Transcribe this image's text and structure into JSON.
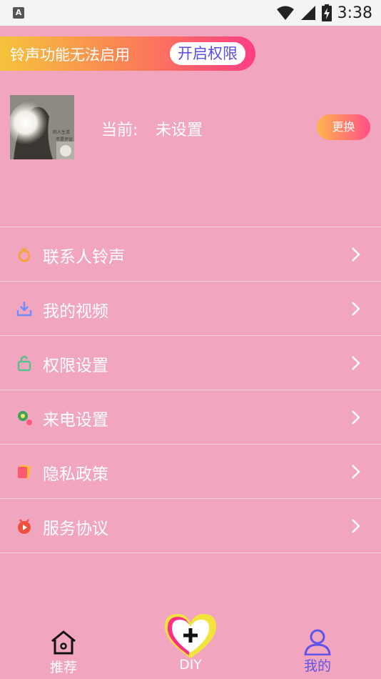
{
  "status_bar": {
    "notification_icon": "A",
    "time": "3:38",
    "icons": [
      "wifi-icon",
      "signal-icon",
      "battery-charging-icon"
    ]
  },
  "banner": {
    "text": "铃声功能无法启用",
    "button_label": "开启权限",
    "colors": {
      "start": "#f6c33c",
      "end": "#ff3d86",
      "button_text": "#5a4ee6"
    }
  },
  "current_ringtone": {
    "label": "当前:",
    "value": "未设置",
    "change_label": "更换",
    "thumbnail_text": [
      "的人生活",
      "不是评论"
    ]
  },
  "menu": {
    "items": [
      {
        "label": "联系人铃声",
        "icon": "ring-icon"
      },
      {
        "label": "我的视频",
        "icon": "download-icon"
      },
      {
        "label": "权限设置",
        "icon": "lock-icon"
      },
      {
        "label": "来电设置",
        "icon": "call-settings-icon"
      },
      {
        "label": "隐私政策",
        "icon": "privacy-icon"
      },
      {
        "label": "服务协议",
        "icon": "agreement-icon"
      }
    ]
  },
  "tabbar": {
    "tabs": [
      {
        "label": "推荐",
        "icon": "home-icon",
        "active": false
      },
      {
        "label": "DIY",
        "icon": "heart-plus-icon",
        "active": false
      },
      {
        "label": "我的",
        "icon": "user-icon",
        "active": true
      }
    ],
    "colors": {
      "active": "#5f55e8",
      "inactive": "#ffffff"
    }
  },
  "colors": {
    "background": "#f2a5bf",
    "divider": "#f7d1de"
  }
}
